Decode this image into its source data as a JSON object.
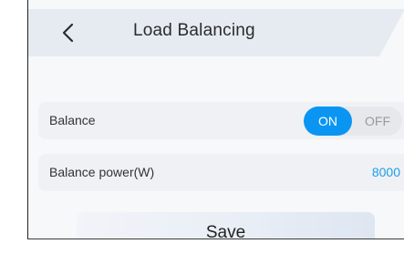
{
  "header": {
    "title": "Load Balancing",
    "back_icon": "chevron-left-icon"
  },
  "settings": {
    "balance": {
      "label": "Balance",
      "on_label": "ON",
      "off_label": "OFF",
      "state": "ON"
    },
    "balance_power": {
      "label": "Balance power(W)",
      "value": "8000"
    }
  },
  "actions": {
    "save_label": "Save"
  },
  "colors": {
    "accent": "#0b95f2",
    "value_text": "#1ba0e8",
    "background": "#f7f8fa",
    "row_background": "#f0f1f4"
  }
}
